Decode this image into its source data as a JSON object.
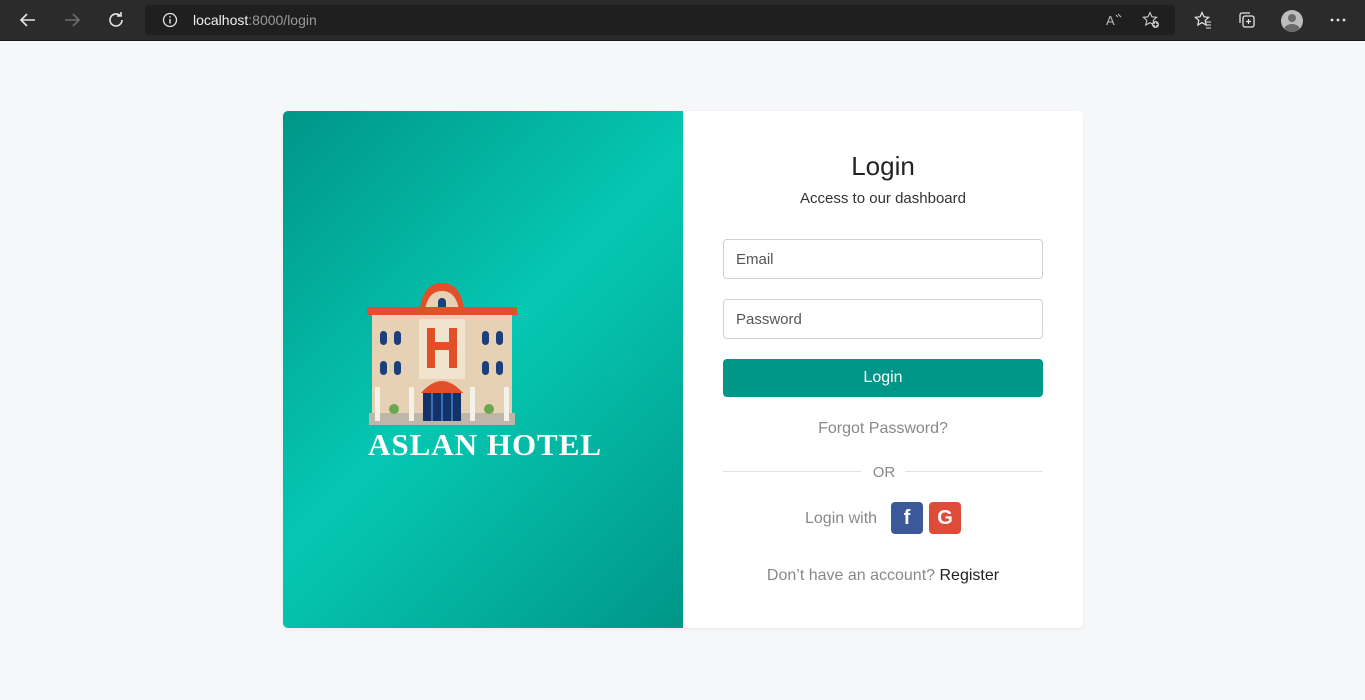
{
  "browser": {
    "url_host": "localhost",
    "url_path": ":8000/login",
    "icons": [
      "back-arrow-icon",
      "forward-arrow-icon",
      "refresh-icon",
      "info-icon",
      "read-aloud-icon",
      "add-favorite-icon",
      "favorites-icon",
      "collections-icon",
      "profile-avatar",
      "more-icon"
    ]
  },
  "brand": {
    "name": "ASLAN HOTEL",
    "logo": "hotel-emoji"
  },
  "login": {
    "title": "Login",
    "subtitle": "Access to our dashboard",
    "email_placeholder": "Email",
    "password_placeholder": "Password",
    "submit_label": "Login",
    "forgot_label": "Forgot Password?",
    "or_label": "OR",
    "login_with_label": "Login with",
    "social": {
      "facebook": "f",
      "google": "G"
    },
    "no_account_label": "Don’t have an account?",
    "register_label": "Register"
  },
  "colors": {
    "primary": "#009688",
    "panel_light": "#05c7b2",
    "facebook": "#3b5998",
    "google": "#dd4b39"
  }
}
